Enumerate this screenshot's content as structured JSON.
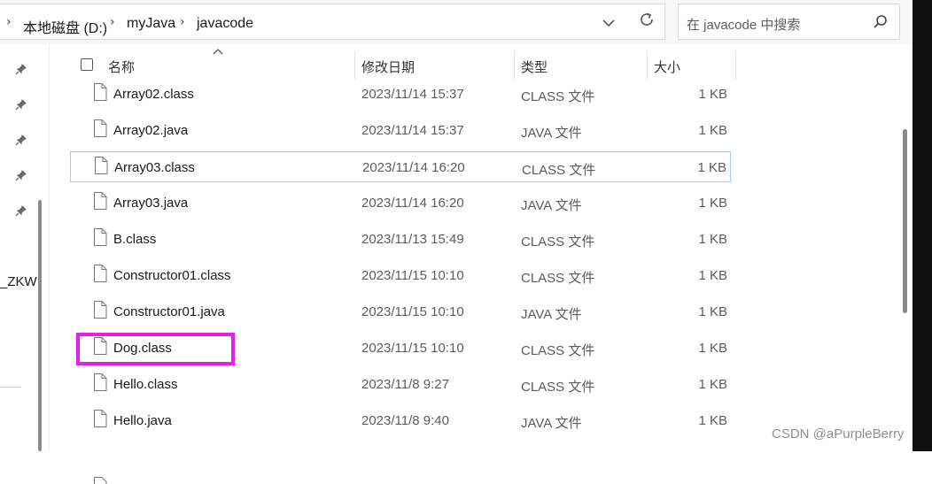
{
  "address_bar": {
    "crumbs": [
      "本地磁盘 (D:)",
      "myJava",
      "javacode"
    ]
  },
  "search": {
    "placeholder": "在 javacode 中搜索"
  },
  "nav_pane": {
    "partial_label": "_ZKW"
  },
  "columns": {
    "name": "名称",
    "date": "修改日期",
    "type": "类型",
    "size": "大小"
  },
  "files": [
    {
      "name": "Array02.class",
      "date": "2023/11/14 15:37",
      "type": "CLASS 文件",
      "size": "1 KB"
    },
    {
      "name": "Array02.java",
      "date": "2023/11/14 15:37",
      "type": "JAVA 文件",
      "size": "1 KB"
    },
    {
      "name": "Array03.class",
      "date": "2023/11/14 16:20",
      "type": "CLASS 文件",
      "size": "1 KB"
    },
    {
      "name": "Array03.java",
      "date": "2023/11/14 16:20",
      "type": "JAVA 文件",
      "size": "1 KB"
    },
    {
      "name": "B.class",
      "date": "2023/11/13 15:49",
      "type": "CLASS 文件",
      "size": "1 KB"
    },
    {
      "name": "Constructor01.class",
      "date": "2023/11/15 10:10",
      "type": "CLASS 文件",
      "size": "1 KB"
    },
    {
      "name": "Constructor01.java",
      "date": "2023/11/15 10:10",
      "type": "JAVA 文件",
      "size": "1 KB"
    },
    {
      "name": "Dog.class",
      "date": "2023/11/15 10:10",
      "type": "CLASS 文件",
      "size": "1 KB"
    },
    {
      "name": "Hello.class",
      "date": "2023/11/8 9:27",
      "type": "CLASS 文件",
      "size": "1 KB"
    },
    {
      "name": "Hello.java",
      "date": "2023/11/8 9:40",
      "type": "JAVA 文件",
      "size": "1 KB"
    }
  ],
  "watermark": "CSDN @aPurpleBerry",
  "colors": {
    "highlight_box": "#e81cf0",
    "selection_border": "#99d1f0"
  }
}
